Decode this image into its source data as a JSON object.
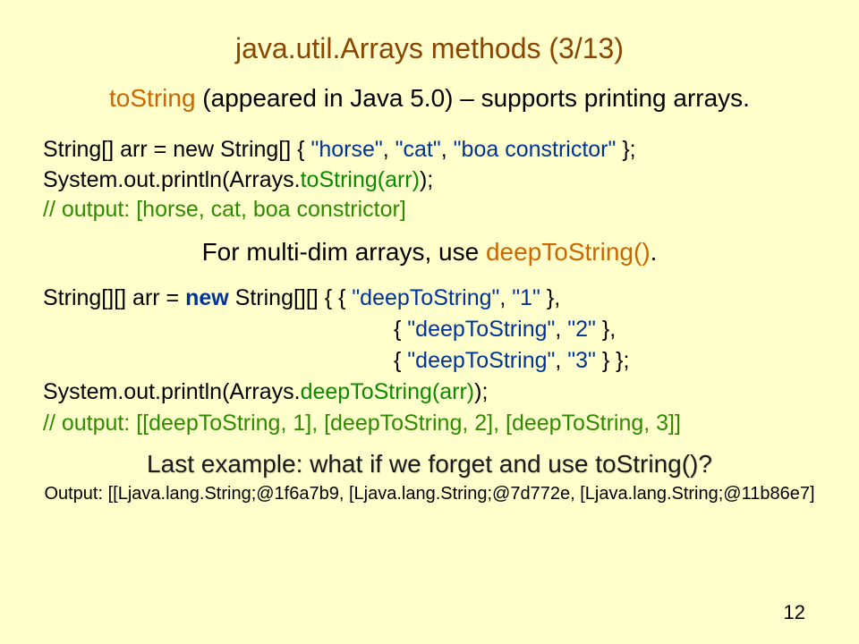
{
  "title": "java.util.Arrays methods (3/13)",
  "subtitle": {
    "method": "toString",
    "rest": " (appeared in Java 5.0) – supports printing arrays."
  },
  "code1": {
    "line1_a": "String[] arr = new String[] { ",
    "line1_b": "\"horse\"",
    "line1_c": ", ",
    "line1_d": "\"cat\"",
    "line1_e": ", ",
    "line1_f": "\"boa constrictor\"",
    "line1_g": " };",
    "line2_a": "System.out.println(Arrays.",
    "line2_b": "toString(arr)",
    "line2_c": ");",
    "line3": "// output: [horse, cat, boa constrictor]"
  },
  "sub2": {
    "a": "For multi-dim arrays, use ",
    "b": "deepToString()",
    "c": "."
  },
  "code2": {
    "l1_a": "String[][] arr = ",
    "l1_new": "new",
    "l1_b": " String[][] {  { ",
    "l1_c": "\"deepToString\"",
    "l1_d": ", ",
    "l1_e": "\"1\"",
    "l1_f": " },",
    "l2_a": "{ ",
    "l2_b": "\"deepToString\"",
    "l2_c": ", ",
    "l2_d": "\"2\"",
    "l2_e": " },",
    "l3_a": "{ ",
    "l3_b": "\"deepToString\"",
    "l3_c": ", ",
    "l3_d": "\"3\"",
    "l3_e": " }  };",
    "l4_a": "System.out.println(Arrays.",
    "l4_b": "deepToString(arr)",
    "l4_c": ");",
    "l5": "// output: [[deepToString, 1], [deepToString, 2], [deepToString, 3]]"
  },
  "last_example": "Last example: what if we forget and use toString()?",
  "output_text": "Output: [[Ljava.lang.String;@1f6a7b9, [Ljava.lang.String;@7d772e, [Ljava.lang.String;@11b86e7]",
  "page_num": "12"
}
